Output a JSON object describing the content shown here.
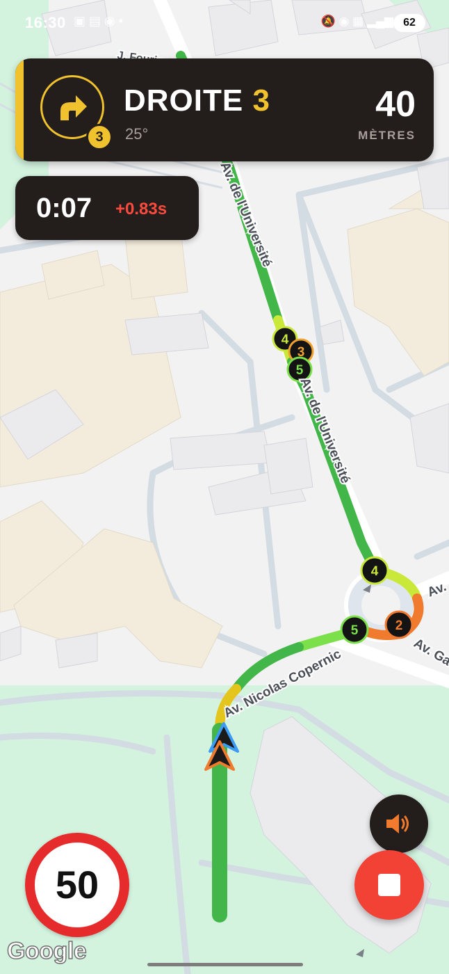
{
  "status_bar": {
    "time": "16:30",
    "left_icons": "▣ ▤ ◉ •",
    "right_icons": "🔕 ◉ ▦ ▂▄▆",
    "battery": "62"
  },
  "navigation": {
    "instruction_word": "DROITE",
    "instruction_number": "3",
    "angle": "25°",
    "turn_badge": "3",
    "turn_icon": "turn-right-arrow-icon",
    "distance": "40",
    "distance_unit": "MÈTRES",
    "accent_color": "#f0c22e"
  },
  "timer": {
    "elapsed": "0:07",
    "delta": "+0.83s"
  },
  "map": {
    "street_labels": [
      "Av. de l'Université",
      "Av. de l'Université",
      "Av. Nicolas Copernic",
      "Av.",
      "Av. Ga",
      "J. Fourier"
    ],
    "waypoint_markers": [
      {
        "label": "4",
        "color": "#c9e83a"
      },
      {
        "label": "3",
        "color": "#f0a12e"
      },
      {
        "label": "5",
        "color": "#7be04a"
      },
      {
        "label": "4",
        "color": "#c9e83a"
      },
      {
        "label": "2",
        "color": "#f07a2e"
      },
      {
        "label": "5",
        "color": "#7be04a"
      }
    ],
    "route_colors": {
      "green": "#43b649",
      "yellow": "#e3c51e",
      "orange": "#f07a2e",
      "lime": "#c9e83a"
    }
  },
  "speed_limit": "50",
  "map_attribution": "Google"
}
